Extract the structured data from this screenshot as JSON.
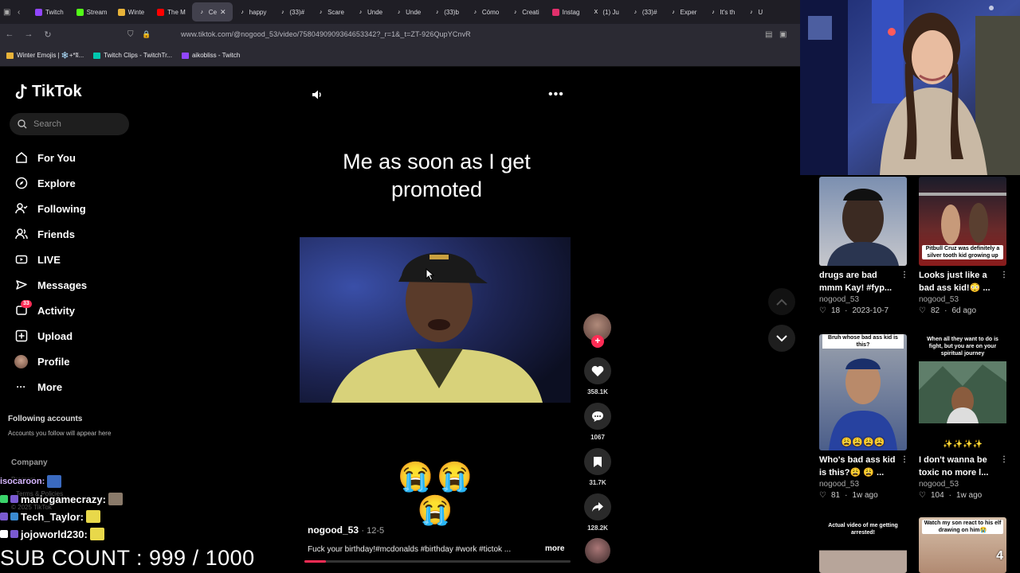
{
  "browser": {
    "tabs": [
      {
        "label": "Twitch",
        "color": "#9146ff"
      },
      {
        "label": "Stream",
        "color": "#53fc18"
      },
      {
        "label": "Winte",
        "color": "#e8b339"
      },
      {
        "label": "The M",
        "color": "#ff0000"
      },
      {
        "label": "Ce",
        "color": "#ffffff",
        "active": true
      },
      {
        "label": "happy",
        "color": "#ffffff"
      },
      {
        "label": "(33)#",
        "color": "#ffffff"
      },
      {
        "label": "Scare",
        "color": "#ffffff"
      },
      {
        "label": "Unde",
        "color": "#ffffff"
      },
      {
        "label": "Unde",
        "color": "#ffffff"
      },
      {
        "label": "(33)b",
        "color": "#ffffff"
      },
      {
        "label": "Cómo",
        "color": "#ffffff"
      },
      {
        "label": "Creati",
        "color": "#ffffff"
      },
      {
        "label": "Instag",
        "color": "#e1306c"
      },
      {
        "label": "(1) Ju",
        "color": "#ffffff"
      },
      {
        "label": "(33)#",
        "color": "#ffffff"
      },
      {
        "label": "Exper",
        "color": "#ffffff"
      },
      {
        "label": "It's th",
        "color": "#ffffff"
      },
      {
        "label": "U",
        "color": "#ffffff"
      }
    ],
    "url": "www.tiktok.com/@nogood_53/video/7580490909364653342?_r=1&_t=ZT-926QupYCnvR",
    "bookmarks": [
      {
        "label": "Winter Emojis | ❄️+*ʬ...",
        "color": "#e8b339"
      },
      {
        "label": "Twitch Clips - TwitchTr...",
        "color": "#00c8af"
      },
      {
        "label": "aikobliss - Twitch",
        "color": "#9146ff"
      }
    ]
  },
  "sidebar": {
    "logo": "TikTok",
    "search_placeholder": "Search",
    "items": [
      {
        "label": "For You",
        "icon": "home-icon"
      },
      {
        "label": "Explore",
        "icon": "compass-icon"
      },
      {
        "label": "Following",
        "icon": "following-icon"
      },
      {
        "label": "Friends",
        "icon": "friends-icon"
      },
      {
        "label": "LIVE",
        "icon": "live-icon"
      },
      {
        "label": "Messages",
        "icon": "messages-icon"
      },
      {
        "label": "Activity",
        "icon": "activity-icon",
        "badge": "33"
      },
      {
        "label": "Upload",
        "icon": "upload-icon"
      },
      {
        "label": "Profile",
        "icon": "profile-avatar"
      },
      {
        "label": "More",
        "icon": "more-icon"
      }
    ],
    "following_title": "Following accounts",
    "following_sub": "Accounts you follow will appear here",
    "company": "Company",
    "program": "Program",
    "terms": "Terms & Policies",
    "copyright": "© 2025 TikTok"
  },
  "video": {
    "caption": "Me as soon as I get promoted",
    "emojis": "😭😭😭",
    "author": "nogood_53",
    "date": "· 12-5",
    "description": "Fuck your birthday!#mcdonalds #birthday #work #tictok ...",
    "more": "more",
    "progress": 0.08,
    "likes": "358.1K",
    "comments": "1067",
    "saves": "31.7K",
    "shares": "128.2K"
  },
  "recommended": [
    {
      "title": "drugs are bad mmm Kay! #fyp...",
      "user": "nogood_53",
      "likes": "18",
      "date": "2023-10-7",
      "overlay": ""
    },
    {
      "title": "Looks just like a bad ass kid!😳 ...",
      "user": "nogood_53",
      "likes": "82",
      "date": "6d ago",
      "overlay": "Pitbull Cruz was definitely a silver tooth kid growing up"
    },
    {
      "title": "Who's bad ass kid is this?😩 😩 ...",
      "user": "nogood_53",
      "likes": "81",
      "date": "1w ago",
      "overlay": "Bruh whose bad ass kid is this?"
    },
    {
      "title": "I don't wanna be toxic no more l...",
      "user": "nogood_53",
      "likes": "104",
      "date": "1w ago",
      "overlay": "When all they want to do is fight, but you are on your spiritual journey"
    },
    {
      "title": "",
      "user": "",
      "likes": "",
      "date": "",
      "overlay": "Actual video of me getting arrested!"
    },
    {
      "title": "",
      "user": "",
      "likes": "",
      "date": "",
      "overlay": "Watch my son react to his elf drawing on him😭"
    }
  ],
  "stream": {
    "chat": [
      {
        "user": "isocaroon:"
      },
      {
        "user": "mariogamecrazy:"
      },
      {
        "user": "Tech_Taylor:"
      },
      {
        "user": "jojoworld230:"
      }
    ],
    "sub_count": "SUB COUNT : 999 / 1000"
  },
  "colors": {
    "accent": "#fe2c55",
    "bg": "#000000"
  }
}
